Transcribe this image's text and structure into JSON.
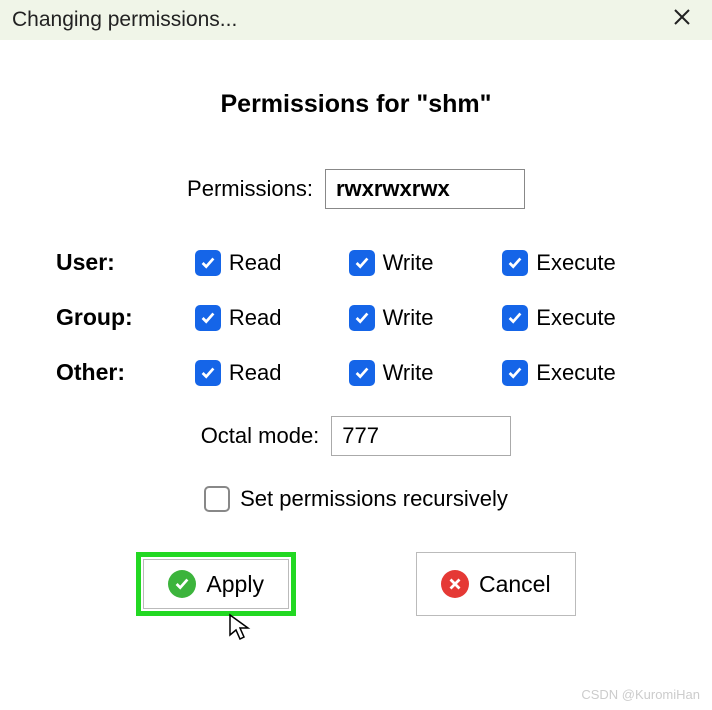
{
  "titlebar": {
    "text": "Changing permissions..."
  },
  "heading": "Permissions for \"shm\"",
  "permissions_label": "Permissions:",
  "permissions_value": "rwxrwxrwx",
  "groups": {
    "user_label": "User:",
    "group_label": "Group:",
    "other_label": "Other:"
  },
  "perms": {
    "read": "Read",
    "write": "Write",
    "execute": "Execute"
  },
  "checks": {
    "user": {
      "read": true,
      "write": true,
      "execute": true
    },
    "group": {
      "read": true,
      "write": true,
      "execute": true
    },
    "other": {
      "read": true,
      "write": true,
      "execute": true
    }
  },
  "octal_label": "Octal mode:",
  "octal_value": "777",
  "recursive_label": "Set permissions recursively",
  "recursive_checked": false,
  "buttons": {
    "apply": "Apply",
    "cancel": "Cancel"
  },
  "watermark": "CSDN @KuromiHan"
}
